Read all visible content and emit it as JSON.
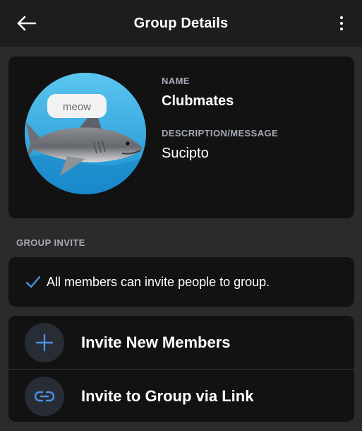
{
  "header": {
    "title": "Group Details"
  },
  "group": {
    "name_label": "NAME",
    "name": "Clubmates",
    "description_label": "DESCRIPTION/MESSAGE",
    "description": "Sucipto",
    "avatar_caption": "meow"
  },
  "invite_section": {
    "header": "GROUP INVITE",
    "permission_text": "All members can invite people to group."
  },
  "actions": [
    {
      "label": "Invite New Members",
      "icon": "plus-icon"
    },
    {
      "label": "Invite to Group via Link",
      "icon": "link-icon"
    }
  ],
  "colors": {
    "accent_blue": "#4a90e2",
    "card_bg": "#121212",
    "page_bg": "#2b2b2b",
    "appbar_bg": "#1d1d1d",
    "muted_label": "#a6abb7",
    "icon_circle": "#272c35"
  }
}
